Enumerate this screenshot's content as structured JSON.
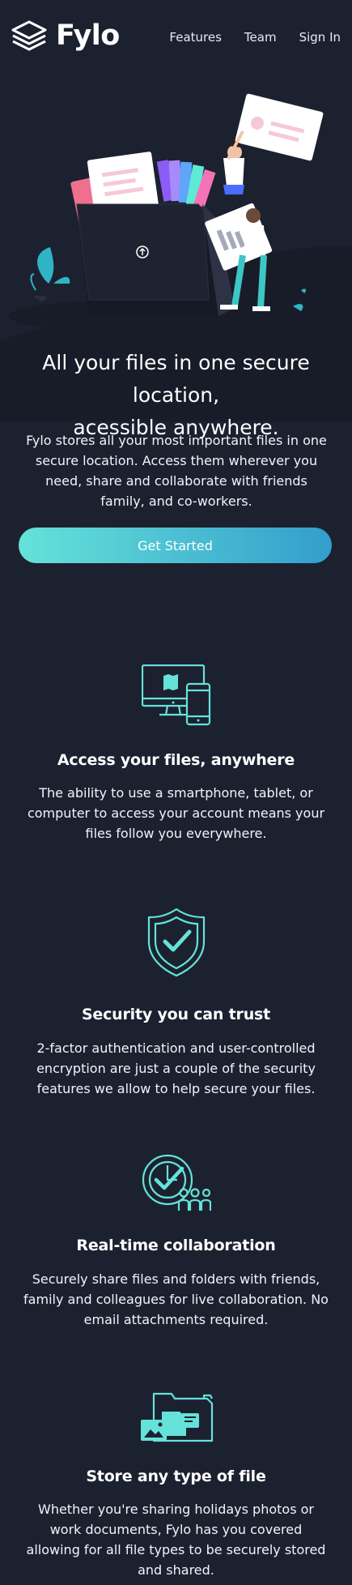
{
  "header": {
    "brand": "Fylo",
    "nav": [
      {
        "label": "Features"
      },
      {
        "label": "Team"
      },
      {
        "label": "Sign In"
      }
    ]
  },
  "hero": {
    "title_line1": "All your files in one secure location,",
    "title_line2": "acessible anywhere.",
    "text": "Fylo stores all your most important files in one secure location. Access them wherever you need, share and collaborate with friends family, and co-workers.",
    "cta_label": "Get Started"
  },
  "features": [
    {
      "icon": "access-anywhere-icon",
      "title": "Access your files, anywhere",
      "text": "The ability to use a smartphone, tablet, or computer to access your account means your files follow you everywhere."
    },
    {
      "icon": "security-shield-icon",
      "title": "Security you can trust",
      "text": "2-factor authentication and user-controlled encryption are just a couple of the security features we allow to help secure your files."
    },
    {
      "icon": "collaboration-icon",
      "title": "Real-time collaboration",
      "text": "Securely share files and folders with friends, family and colleagues for live collaboration. No email attachments required."
    },
    {
      "icon": "any-file-icon",
      "title": "Store any type of file",
      "text": "Whether you're sharing holidays photos or work documents, Fylo has you covered allowing for all file types to be securely stored and shared."
    }
  ],
  "colors": {
    "background": "#1c2130",
    "accent_start": "#65e2d9",
    "accent_end": "#339ecc",
    "icon_teal": "#65e2d9"
  }
}
